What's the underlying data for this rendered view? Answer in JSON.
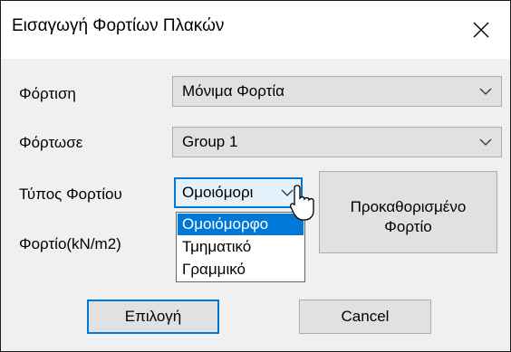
{
  "window": {
    "title": "Εισαγωγή Φορτίων Πλακών"
  },
  "form": {
    "loading_label": "Φόρτιση",
    "loading_value": "Μόνιμα Φορτία",
    "load_to_label": "Φόρτωσε",
    "load_to_value": "Group 1",
    "load_type_label": "Τύπος Φορτίου",
    "load_type_value": "Ομοιόμορι",
    "load_label": "Φορτίο(kN/m2)"
  },
  "dropdown": {
    "options": [
      "Ομοιόμορφο",
      "Τμηματικό",
      "Γραμμικό"
    ],
    "selected_index": 0
  },
  "buttons": {
    "predefined_line1": "Προκαθορισμένο",
    "predefined_line2": "Φορτίο",
    "ok": "Επιλογή",
    "cancel": "Cancel"
  },
  "colors": {
    "accent": "#0078d7",
    "button_face": "#e1e1e1",
    "dialog_bg": "#f0f0f0"
  },
  "icons": {
    "close": "close-icon",
    "chevron": "chevron-down-icon",
    "cursor": "mouse-pointer-icon"
  }
}
